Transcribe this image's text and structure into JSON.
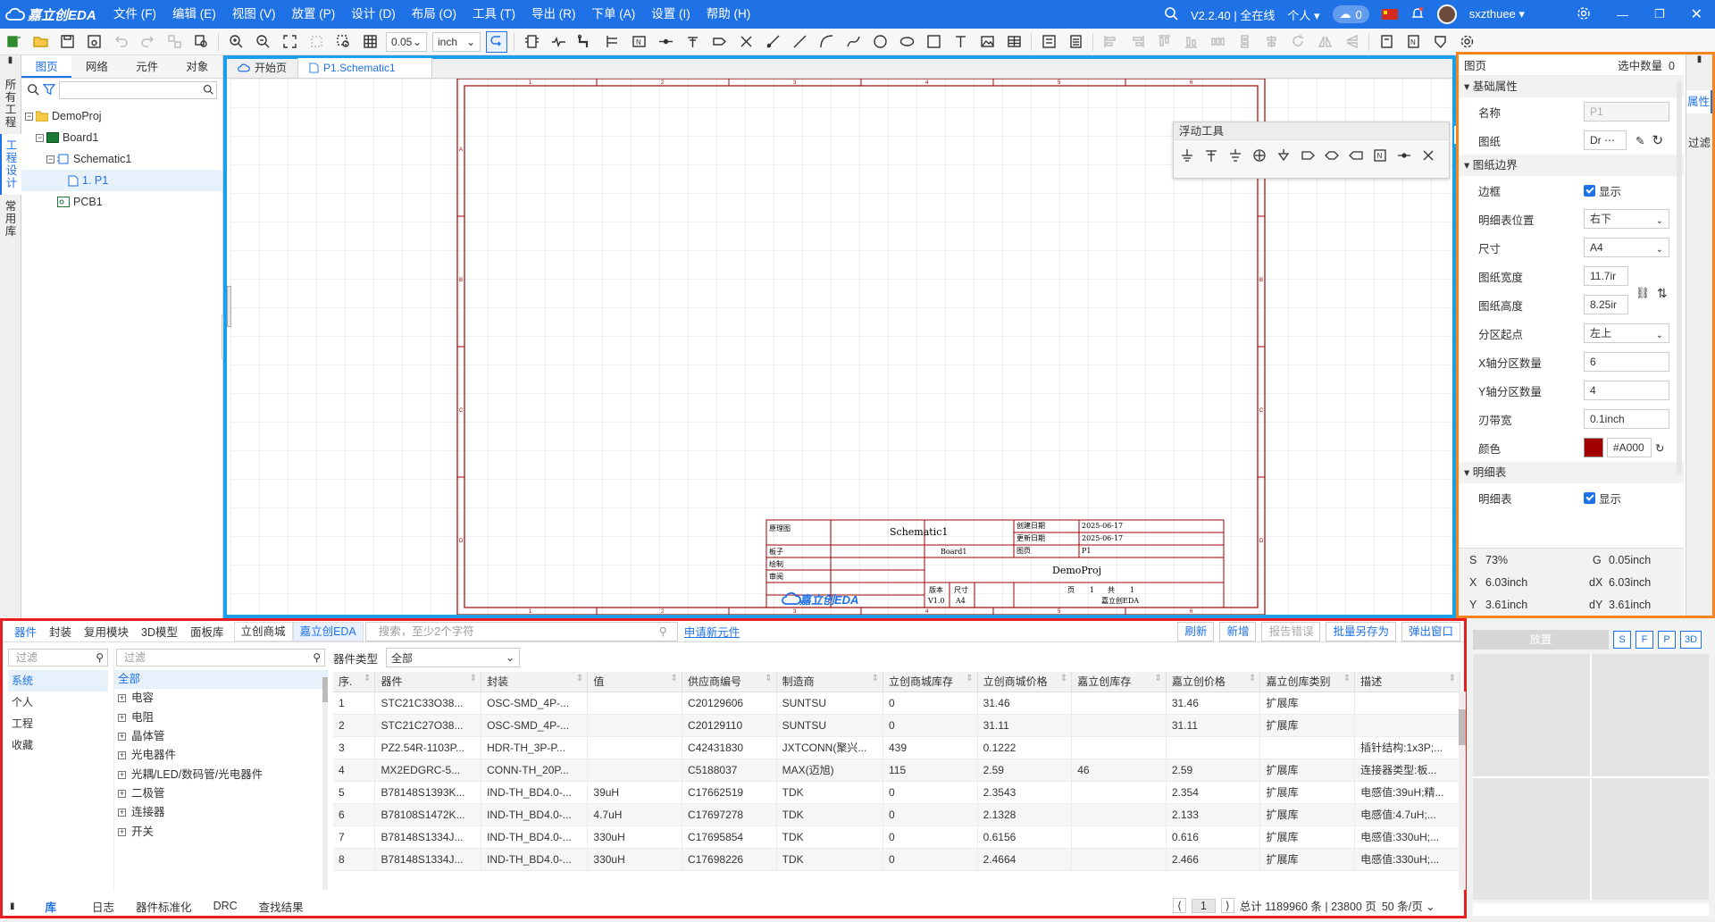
{
  "app": {
    "logo_text": "嘉立创EDA",
    "version": "V2.2.40 | 全在线",
    "account_mode": "个人",
    "cloud_count": "0",
    "username": "sxzthuee"
  },
  "menu": [
    "文件 (F)",
    "编辑 (E)",
    "视图 (V)",
    "放置 (P)",
    "设计 (D)",
    "布局 (O)",
    "工具 (T)",
    "导出 (R)",
    "下单 (A)",
    "设置 (I)",
    "帮助 (H)"
  ],
  "toolbar": {
    "grid_value": "0.05",
    "unit_value": "inch"
  },
  "left_vtabs": [
    "所有工程",
    "工程设计",
    "常用库"
  ],
  "project": {
    "tabs": [
      "图页",
      "网络",
      "元件",
      "对象"
    ],
    "tree": [
      {
        "label": "DemoProj",
        "level": 0,
        "icon": "folder-icon"
      },
      {
        "label": "Board1",
        "level": 1,
        "icon": "board-icon"
      },
      {
        "label": "Schematic1",
        "level": 2,
        "icon": "schematic-icon"
      },
      {
        "label": "1. P1",
        "level": 3,
        "icon": "page-icon"
      },
      {
        "label": "PCB1",
        "level": 2,
        "icon": "pcb-icon"
      }
    ]
  },
  "doc_tabs": [
    {
      "label": "开始页",
      "icon": "cloud-icon"
    },
    {
      "label": "P1.Schematic1",
      "icon": "page-icon"
    }
  ],
  "float_tools": {
    "title": "浮动工具"
  },
  "sheet": {
    "row_letters": [
      "A",
      "B",
      "C",
      "D"
    ],
    "col_numbers": [
      "1",
      "2",
      "3",
      "4",
      "5",
      "6"
    ],
    "title_block": {
      "label_schematic": "原理图",
      "schematic_name": "Schematic1",
      "label_created": "创建日期",
      "created": "2025-06-17",
      "label_updated": "更新日期",
      "updated": "2025-06-17",
      "label_board": "板子",
      "board": "Board1",
      "label_page": "图页",
      "page": "P1",
      "label_draw": "绘制",
      "label_review": "审阅",
      "project": "DemoProj",
      "label_version": "版本",
      "label_size": "尺寸",
      "version": "V1.0",
      "size": "A4",
      "page_label": "页",
      "page_num": "1",
      "total_label": "共",
      "total_num": "1",
      "logo_text": "嘉立创EDA",
      "company": "嘉立创EDA"
    }
  },
  "props": {
    "header": "图页",
    "selected_label": "选中数量",
    "selected_count": "0",
    "sec_basic": "基础属性",
    "name_label": "名称",
    "name_value": "P1",
    "drawing_label": "图纸",
    "drawing_value": "Dr",
    "sec_border": "图纸边界",
    "border_label": "边框",
    "border_value": "显示",
    "tb_pos_label": "明细表位置",
    "tb_pos_value": "右下",
    "size_label": "尺寸",
    "size_value": "A4",
    "width_label": "图纸宽度",
    "width_value": "11.7ir",
    "height_label": "图纸高度",
    "height_value": "8.25ir",
    "zone_start_label": "分区起点",
    "zone_start_value": "左上",
    "x_zones_label": "X轴分区数量",
    "x_zones_value": "6",
    "y_zones_label": "Y轴分区数量",
    "y_zones_value": "4",
    "margin_label": "刃带宽",
    "margin_value": "0.1inch",
    "color_label": "颜色",
    "color_value": "#A000",
    "color_swatch": "#a00000",
    "sec_tb": "明细表",
    "tb_label": "明细表",
    "tb_value": "显示"
  },
  "right_vtabs": [
    "属性",
    "过滤"
  ],
  "coords": {
    "s_label": "S",
    "s": "73%",
    "g_label": "G",
    "g": "0.05inch",
    "x_label": "X",
    "x": "6.03inch",
    "dx_label": "dX",
    "dx": "6.03inch",
    "y_label": "Y",
    "y": "3.61inch",
    "dy_label": "dY",
    "dy": "3.61inch"
  },
  "library": {
    "tabs": [
      "器件",
      "封装",
      "复用模块",
      "3D模型",
      "面板库"
    ],
    "source_tabs": [
      "立创商城",
      "嘉立创EDA"
    ],
    "search_placeholder": "搜索，至少2个字符",
    "apply_link": "申请新元件",
    "buttons": [
      "刷新",
      "新增",
      "报告错误",
      "批量另存为",
      "弹出窗口"
    ],
    "filter_placeholder": "过滤",
    "scopes": [
      "系统",
      "个人",
      "工程",
      "收藏"
    ],
    "category_filter_placeholder": "过滤",
    "categories": [
      "全部",
      "电容",
      "电阻",
      "晶体管",
      "光电器件",
      "光耦/LED/数码管/光电器件",
      "二极管",
      "连接器",
      "开关"
    ],
    "type_label": "器件类型",
    "type_value": "全部",
    "columns": [
      "序.",
      "器件",
      "封装",
      "值",
      "供应商编号",
      "制造商",
      "立创商城库存",
      "立创商城价格",
      "嘉立创库存",
      "嘉立创价格",
      "嘉立创库类别",
      "描述"
    ],
    "rows": [
      [
        "1",
        "STC21C33O38...",
        "OSC-SMD_4P-...",
        "",
        "C20129606",
        "SUNTSU",
        "0",
        "31.46",
        "",
        "31.46",
        "扩展库",
        ""
      ],
      [
        "2",
        "STC21C27O38...",
        "OSC-SMD_4P-...",
        "",
        "C20129110",
        "SUNTSU",
        "0",
        "31.11",
        "",
        "31.11",
        "扩展库",
        ""
      ],
      [
        "3",
        "PZ2.54R-1103P...",
        "HDR-TH_3P-P...",
        "",
        "C42431830",
        "JXTCONN(聚兴...",
        "439",
        "0.1222",
        "",
        "",
        "",
        "插针结构:1x3P;..."
      ],
      [
        "4",
        "MX2EDGRC-5...",
        "CONN-TH_20P...",
        "",
        "C5188037",
        "MAX(迈旭)",
        "115",
        "2.59",
        "46",
        "2.59",
        "扩展库",
        "连接器类型:板..."
      ],
      [
        "5",
        "B78148S1393K...",
        "IND-TH_BD4.0-...",
        "39uH",
        "C17662519",
        "TDK",
        "0",
        "2.3543",
        "",
        "2.354",
        "扩展库",
        "电感值:39uH;精..."
      ],
      [
        "6",
        "B78108S1472K...",
        "IND-TH_BD4.0-...",
        "4.7uH",
        "C17697278",
        "TDK",
        "0",
        "2.1328",
        "",
        "2.133",
        "扩展库",
        "电感值:4.7uH;..."
      ],
      [
        "7",
        "B78148S1334J...",
        "IND-TH_BD4.0-...",
        "330uH",
        "C17695854",
        "TDK",
        "0",
        "0.6156",
        "",
        "0.616",
        "扩展库",
        "电感值:330uH;..."
      ],
      [
        "8",
        "B78148S1334J...",
        "IND-TH_BD4.0-...",
        "330uH",
        "C17698226",
        "TDK",
        "0",
        "2.4664",
        "",
        "2.466",
        "扩展库",
        "电感值:330uH;..."
      ]
    ],
    "pagination": {
      "page": "1",
      "summary": "总计 1189960 条 | 23800 页",
      "per_page": "50 条/页"
    }
  },
  "bottom_tabs": [
    "库",
    "日志",
    "器件标准化",
    "DRC",
    "查找结果"
  ],
  "place_panel": {
    "title": "放置",
    "buttons": [
      "S",
      "F",
      "P",
      "3D"
    ]
  }
}
